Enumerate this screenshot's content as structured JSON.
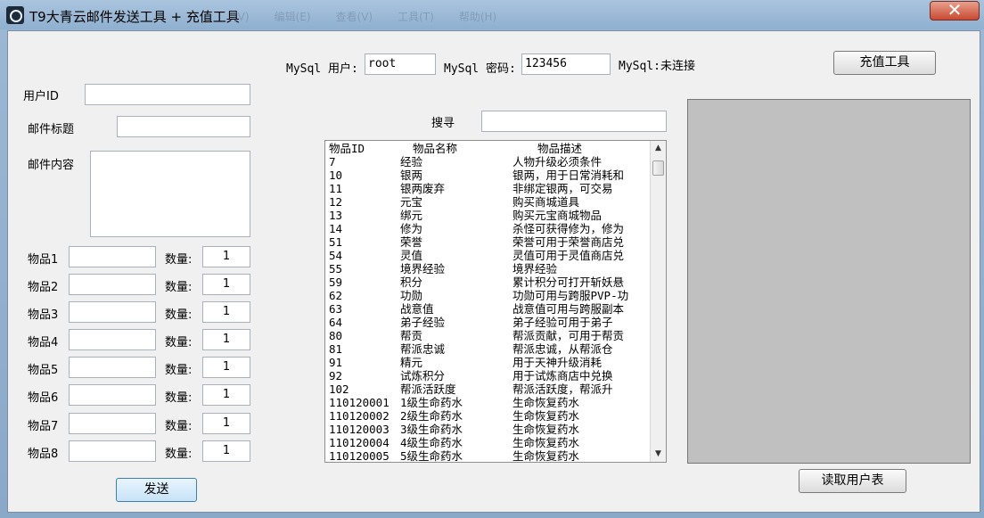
{
  "window": {
    "title": "T9大青云邮件发送工具 + 充值工具",
    "close_label": "✕",
    "app_icon": "gear-app-icon"
  },
  "mysql": {
    "user_label": "MySql 用户:",
    "user_value": "root",
    "password_label": "MySql 密码:",
    "password_value": "123456",
    "status": "MySql:未连接"
  },
  "buttons": {
    "recharge": "充值工具",
    "send": "发送",
    "read_users": "读取用户表"
  },
  "form": {
    "user_id_label": "用户ID",
    "mail_title_label": "邮件标题",
    "mail_content_label": "邮件内容"
  },
  "items": [
    {
      "label": "物品1",
      "qty_label": "数量:",
      "qty": "1"
    },
    {
      "label": "物品2",
      "qty_label": "数量:",
      "qty": "1"
    },
    {
      "label": "物品3",
      "qty_label": "数量:",
      "qty": "1"
    },
    {
      "label": "物品4",
      "qty_label": "数量:",
      "qty": "1"
    },
    {
      "label": "物品5",
      "qty_label": "数量:",
      "qty": "1"
    },
    {
      "label": "物品6",
      "qty_label": "数量:",
      "qty": "1"
    },
    {
      "label": "物品7",
      "qty_label": "数量:",
      "qty": "1"
    },
    {
      "label": "物品8",
      "qty_label": "数量:",
      "qty": "1"
    }
  ],
  "search": {
    "label": "搜寻"
  },
  "list": {
    "headers": [
      "物品ID",
      "物品名称",
      "物品描述"
    ],
    "rows": [
      [
        "7",
        "经验",
        "人物升级必须条件"
      ],
      [
        "10",
        "银两",
        "银两，用于日常消耗和"
      ],
      [
        "11",
        "银两废弃",
        "非绑定银两，可交易"
      ],
      [
        "12",
        "元宝",
        "购买商城道具"
      ],
      [
        "13",
        "绑元",
        "购买元宝商城物品"
      ],
      [
        "14",
        "修为",
        "杀怪可获得修为，修为"
      ],
      [
        "51",
        "荣誉",
        "荣誉可用于荣誉商店兑"
      ],
      [
        "54",
        "灵值",
        "灵值可用于灵值商店兑"
      ],
      [
        "55",
        "境界经验",
        "境界经验"
      ],
      [
        "59",
        "积分",
        "累计积分可打开斩妖悬"
      ],
      [
        "62",
        "功勋",
        "功勋可用与跨服PVP-功"
      ],
      [
        "63",
        "战意值",
        "战意值可用与跨服副本"
      ],
      [
        "64",
        "弟子经验",
        "弟子经验可用于弟子"
      ],
      [
        "80",
        "帮贡",
        "帮派贡献，可用于帮贡"
      ],
      [
        "81",
        "帮派忠诚",
        "帮派忠诚，从帮派仓"
      ],
      [
        "91",
        "精元",
        "用于天神升级消耗"
      ],
      [
        "92",
        "试炼积分",
        "用于试炼商店中兑换"
      ],
      [
        "102",
        "帮派活跃度",
        "帮派活跃度，帮派升"
      ],
      [
        "110120001",
        "1级生命药水",
        "生命恢复药水"
      ],
      [
        "110120002",
        "2级生命药水",
        "生命恢复药水"
      ],
      [
        "110120003",
        "3级生命药水",
        "生命恢复药水"
      ],
      [
        "110120004",
        "4级生命药水",
        "生命恢复药水"
      ],
      [
        "110120005",
        "5级生命药水",
        "生命恢复药水"
      ]
    ]
  }
}
